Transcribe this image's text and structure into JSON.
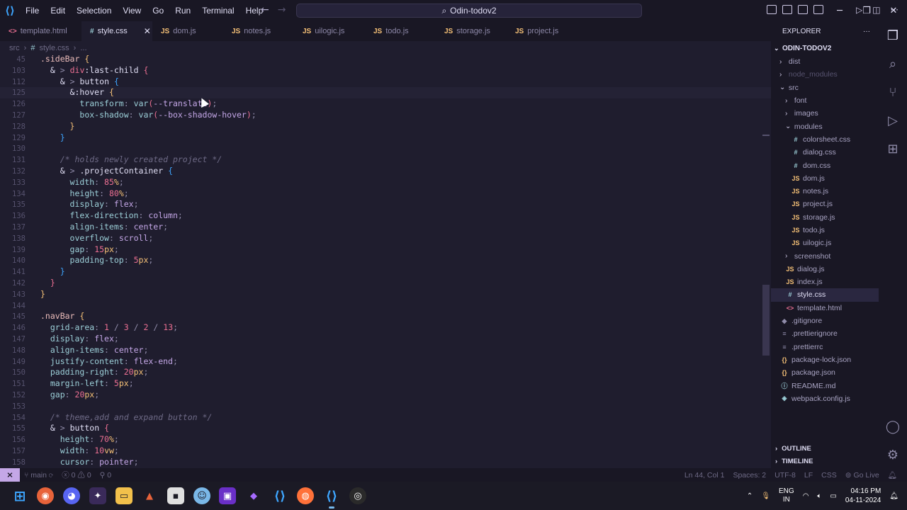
{
  "titlebar": {
    "menu": [
      "File",
      "Edit",
      "Selection",
      "View",
      "Go",
      "Run",
      "Terminal",
      "Help"
    ],
    "search_text": "Odin-todov2"
  },
  "tabs": [
    {
      "icon": "<>",
      "kind": "html",
      "label": "template.html",
      "active": false
    },
    {
      "icon": "#",
      "kind": "css",
      "label": "style.css",
      "active": true
    },
    {
      "icon": "JS",
      "kind": "js",
      "label": "dom.js",
      "active": false
    },
    {
      "icon": "JS",
      "kind": "js",
      "label": "notes.js",
      "active": false
    },
    {
      "icon": "JS",
      "kind": "js",
      "label": "uilogic.js",
      "active": false
    },
    {
      "icon": "JS",
      "kind": "js",
      "label": "todo.js",
      "active": false
    },
    {
      "icon": "JS",
      "kind": "js",
      "label": "storage.js",
      "active": false
    },
    {
      "icon": "JS",
      "kind": "js",
      "label": "project.js",
      "active": false
    }
  ],
  "breadcrumb": {
    "folder": "src",
    "file": "style.css",
    "more": "..."
  },
  "code_lines": [
    {
      "n": "45",
      "html": "<span class='t-sel'>.sideBar</span> <span class='t-br1'>{</span>"
    },
    {
      "n": "103",
      "html": "  <span class='t-amp'>&amp;</span> <span class='t-punc'>&gt;</span> <span class='t-num'>div</span><span class='t-fn'>:last-child</span> <span class='t-br2'>{</span>"
    },
    {
      "n": "112",
      "html": "    <span class='t-amp'>&amp;</span> <span class='t-punc'>&gt;</span> <span class='t-fn'>button</span> <span class='t-br3'>{</span>"
    },
    {
      "n": "125",
      "html": "      <span class='t-amp'>&amp;</span><span class='t-fn'>:hover</span> <span class='t-br1'>{</span>",
      "cur": true
    },
    {
      "n": "126",
      "html": "        <span class='t-prop'>transform</span><span class='t-punc'>:</span> <span class='t-prop'>var</span><span class='t-br2'>(</span><span class='t-val'>--translate</span><span class='t-br2'>)</span><span class='t-punc'>;</span>"
    },
    {
      "n": "127",
      "html": "        <span class='t-prop'>box-shadow</span><span class='t-punc'>:</span> <span class='t-prop'>var</span><span class='t-br2'>(</span><span class='t-val'>--box-shadow-hover</span><span class='t-br2'>)</span><span class='t-punc'>;</span>"
    },
    {
      "n": "128",
      "html": "      <span class='t-br1'>}</span>"
    },
    {
      "n": "129",
      "html": "    <span class='t-br3'>}</span>"
    },
    {
      "n": "130",
      "html": ""
    },
    {
      "n": "131",
      "html": "    <span class='t-cmt'>/* holds newly created project */</span>"
    },
    {
      "n": "132",
      "html": "    <span class='t-amp'>&amp;</span> <span class='t-punc'>&gt;</span> <span class='t-fn'>.projectContainer</span> <span class='t-br3'>{</span>"
    },
    {
      "n": "133",
      "html": "      <span class='t-prop'>width</span><span class='t-punc'>:</span> <span class='t-num'>85</span><span class='t-unit'>%</span><span class='t-punc'>;</span>"
    },
    {
      "n": "134",
      "html": "      <span class='t-prop'>height</span><span class='t-punc'>:</span> <span class='t-num'>80</span><span class='t-unit'>%</span><span class='t-punc'>;</span>"
    },
    {
      "n": "135",
      "html": "      <span class='t-prop'>display</span><span class='t-punc'>:</span> <span class='t-val'>flex</span><span class='t-punc'>;</span>"
    },
    {
      "n": "136",
      "html": "      <span class='t-prop'>flex-direction</span><span class='t-punc'>:</span> <span class='t-val'>column</span><span class='t-punc'>;</span>"
    },
    {
      "n": "137",
      "html": "      <span class='t-prop'>align-items</span><span class='t-punc'>:</span> <span class='t-val'>center</span><span class='t-punc'>;</span>"
    },
    {
      "n": "138",
      "html": "      <span class='t-prop'>overflow</span><span class='t-punc'>:</span> <span class='t-val'>scroll</span><span class='t-punc'>;</span>"
    },
    {
      "n": "139",
      "html": "      <span class='t-prop'>gap</span><span class='t-punc'>:</span> <span class='t-num'>15</span><span class='t-unit'>px</span><span class='t-punc'>;</span>"
    },
    {
      "n": "140",
      "html": "      <span class='t-prop'>padding-top</span><span class='t-punc'>:</span> <span class='t-num'>5</span><span class='t-unit'>px</span><span class='t-punc'>;</span>"
    },
    {
      "n": "141",
      "html": "    <span class='t-br3'>}</span>"
    },
    {
      "n": "142",
      "html": "  <span class='t-br2'>}</span>"
    },
    {
      "n": "143",
      "html": "<span class='t-br1'>}</span>"
    },
    {
      "n": "144",
      "html": ""
    },
    {
      "n": "145",
      "html": "<span class='t-sel'>.navBar</span> <span class='t-br1'>{</span>"
    },
    {
      "n": "146",
      "html": "  <span class='t-prop'>grid-area</span><span class='t-punc'>:</span> <span class='t-num'>1</span> <span class='t-punc'>/</span> <span class='t-num'>3</span> <span class='t-punc'>/</span> <span class='t-num'>2</span> <span class='t-punc'>/</span> <span class='t-num'>13</span><span class='t-punc'>;</span>"
    },
    {
      "n": "147",
      "html": "  <span class='t-prop'>display</span><span class='t-punc'>:</span> <span class='t-val'>flex</span><span class='t-punc'>;</span>"
    },
    {
      "n": "148",
      "html": "  <span class='t-prop'>align-items</span><span class='t-punc'>:</span> <span class='t-val'>center</span><span class='t-punc'>;</span>"
    },
    {
      "n": "149",
      "html": "  <span class='t-prop'>justify-content</span><span class='t-punc'>:</span> <span class='t-val'>flex-end</span><span class='t-punc'>;</span>"
    },
    {
      "n": "150",
      "html": "  <span class='t-prop'>padding-right</span><span class='t-punc'>:</span> <span class='t-num'>20</span><span class='t-unit'>px</span><span class='t-punc'>;</span>"
    },
    {
      "n": "151",
      "html": "  <span class='t-prop'>margin-left</span><span class='t-punc'>:</span> <span class='t-num'>5</span><span class='t-unit'>px</span><span class='t-punc'>;</span>"
    },
    {
      "n": "152",
      "html": "  <span class='t-prop'>gap</span><span class='t-punc'>:</span> <span class='t-num'>20</span><span class='t-unit'>px</span><span class='t-punc'>;</span>"
    },
    {
      "n": "153",
      "html": ""
    },
    {
      "n": "154",
      "html": "  <span class='t-cmt'>/* theme,add and expand button */</span>"
    },
    {
      "n": "155",
      "html": "  <span class='t-amp'>&amp;</span> <span class='t-punc'>&gt;</span> <span class='t-fn'>button</span> <span class='t-br2'>{</span>"
    },
    {
      "n": "156",
      "html": "    <span class='t-prop'>height</span><span class='t-punc'>:</span> <span class='t-num'>70</span><span class='t-unit'>%</span><span class='t-punc'>;</span>"
    },
    {
      "n": "157",
      "html": "    <span class='t-prop'>width</span><span class='t-punc'>:</span> <span class='t-num'>10</span><span class='t-unit'>vw</span><span class='t-punc'>;</span>"
    },
    {
      "n": "158",
      "html": "    <span class='t-prop'>cursor</span><span class='t-punc'>:</span> <span class='t-val'>pointer</span><span class='t-punc'>;</span>"
    }
  ],
  "explorer": {
    "title": "EXPLORER",
    "root": "ODIN-TODOV2",
    "items": [
      {
        "label": "dist",
        "type": "folder",
        "open": false,
        "depth": 1
      },
      {
        "label": "node_modules",
        "type": "folder",
        "open": false,
        "depth": 1,
        "dim": true
      },
      {
        "label": "src",
        "type": "folder",
        "open": true,
        "depth": 1
      },
      {
        "label": "font",
        "type": "folder",
        "open": false,
        "depth": 2
      },
      {
        "label": "images",
        "type": "folder",
        "open": false,
        "depth": 2
      },
      {
        "label": "modules",
        "type": "folder",
        "open": true,
        "depth": 2
      },
      {
        "label": "colorsheet.css",
        "type": "css",
        "icon": "#",
        "depth": 3
      },
      {
        "label": "dialog.css",
        "type": "css",
        "icon": "#",
        "depth": 3
      },
      {
        "label": "dom.css",
        "type": "css",
        "icon": "#",
        "depth": 3
      },
      {
        "label": "dom.js",
        "type": "js",
        "icon": "JS",
        "depth": 3
      },
      {
        "label": "notes.js",
        "type": "js",
        "icon": "JS",
        "depth": 3
      },
      {
        "label": "project.js",
        "type": "js",
        "icon": "JS",
        "depth": 3
      },
      {
        "label": "storage.js",
        "type": "js",
        "icon": "JS",
        "depth": 3
      },
      {
        "label": "todo.js",
        "type": "js",
        "icon": "JS",
        "depth": 3
      },
      {
        "label": "uilogic.js",
        "type": "js",
        "icon": "JS",
        "depth": 3
      },
      {
        "label": "screenshot",
        "type": "folder",
        "open": false,
        "depth": 2
      },
      {
        "label": "dialog.js",
        "type": "js",
        "icon": "JS",
        "depth": 2
      },
      {
        "label": "index.js",
        "type": "js",
        "icon": "JS",
        "depth": 2
      },
      {
        "label": "style.css",
        "type": "css",
        "icon": "#",
        "depth": 2,
        "selected": true
      },
      {
        "label": "template.html",
        "type": "html",
        "icon": "<>",
        "depth": 2
      },
      {
        "label": ".gitignore",
        "type": "txt",
        "icon": "◆",
        "depth": 1
      },
      {
        "label": ".prettierignore",
        "type": "txt",
        "icon": "≡",
        "depth": 1
      },
      {
        "label": ".prettierrc",
        "type": "txt",
        "icon": "≡",
        "depth": 1
      },
      {
        "label": "package-lock.json",
        "type": "json",
        "icon": "{}",
        "depth": 1
      },
      {
        "label": "package.json",
        "type": "json",
        "icon": "{}",
        "depth": 1
      },
      {
        "label": "README.md",
        "type": "md",
        "icon": "ⓘ",
        "depth": 1
      },
      {
        "label": "webpack.config.js",
        "type": "wp",
        "icon": "◈",
        "depth": 1
      }
    ],
    "outline": "OUTLINE",
    "timeline": "TIMELINE"
  },
  "statusbar": {
    "branch": "main",
    "errors": "0",
    "warnings": "0",
    "ports": "0",
    "position": "Ln 44, Col 1",
    "spaces": "Spaces: 2",
    "encoding": "UTF-8",
    "eol": "LF",
    "language": "CSS",
    "golive": "Go Live"
  },
  "taskbar": {
    "lang_line1": "ENG",
    "lang_line2": "IN",
    "time": "04:16 PM",
    "date": "04-11-2024"
  },
  "colors": {
    "accent": "#c4a7e7",
    "bg": "#1f1d2e",
    "panel": "#191724"
  }
}
